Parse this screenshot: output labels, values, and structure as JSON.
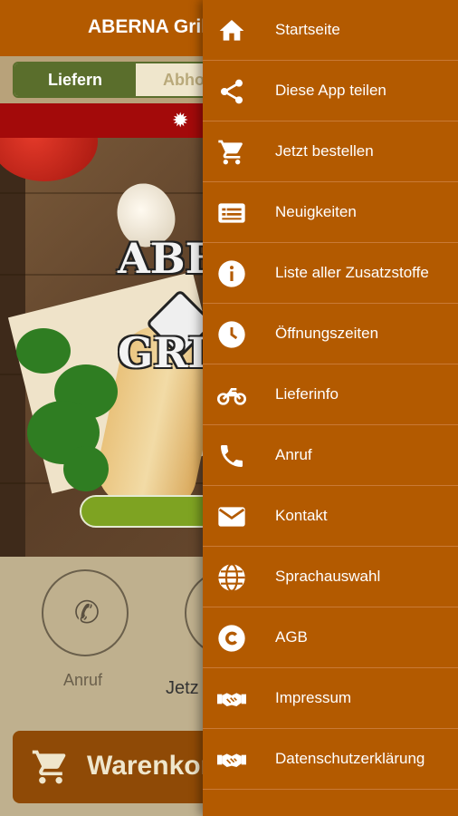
{
  "app": {
    "title": "ABERNA Grill",
    "tabs": {
      "deliver": "Liefern",
      "pickup": "Abho"
    },
    "hero": {
      "logo_line1": "ABE",
      "logo_line2": "GRIL"
    },
    "actions": {
      "call_label": "Anruf",
      "order_label": "Jetz"
    },
    "cart_label": "Warenkorb"
  },
  "drawer": {
    "items": [
      {
        "label": "Startseite",
        "icon": "home-icon"
      },
      {
        "label": "Diese App teilen",
        "icon": "share-icon"
      },
      {
        "label": "Jetzt bestellen",
        "icon": "cart-icon"
      },
      {
        "label": "Neuigkeiten",
        "icon": "news-icon"
      },
      {
        "label": "Liste aller Zusatzstoffe",
        "icon": "info-icon"
      },
      {
        "label": "Öffnungszeiten",
        "icon": "clock-icon"
      },
      {
        "label": "Lieferinfo",
        "icon": "motorbike-icon"
      },
      {
        "label": "Anruf",
        "icon": "phone-icon"
      },
      {
        "label": "Kontakt",
        "icon": "mail-icon"
      },
      {
        "label": "Sprachauswahl",
        "icon": "globe-icon"
      },
      {
        "label": "AGB",
        "icon": "copyright-icon"
      },
      {
        "label": "Impressum",
        "icon": "handshake-icon"
      },
      {
        "label": "Datenschutzerklärung",
        "icon": "handshake-icon"
      }
    ]
  },
  "colors": {
    "header": "#b35a00",
    "drawer": "#b35a00",
    "tab_active": "#5a6e2c",
    "alert": "#a30a0a",
    "cart_bar": "#8f4a06"
  }
}
